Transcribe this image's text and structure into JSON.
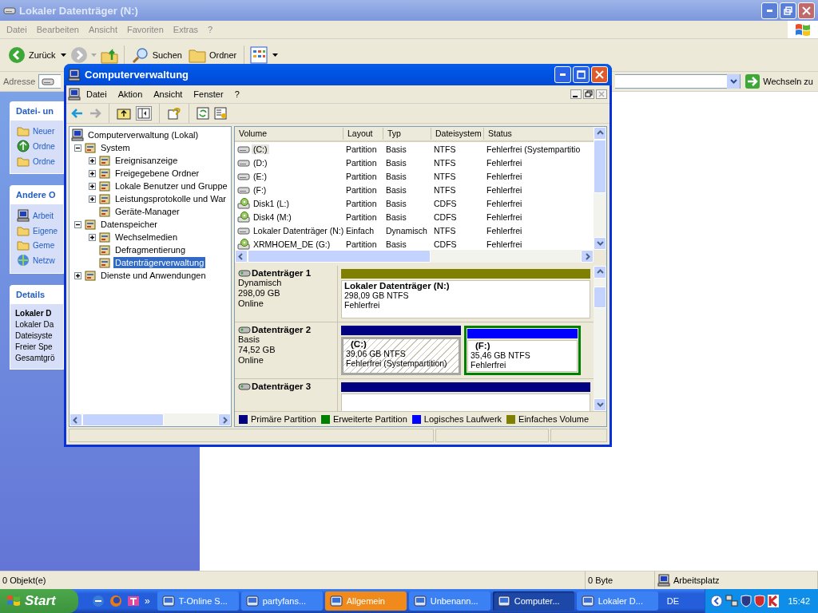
{
  "explorer": {
    "title": "Lokaler Datenträger (N:)",
    "menu": [
      "Datei",
      "Bearbeiten",
      "Ansicht",
      "Favoriten",
      "Extras",
      "?"
    ],
    "toolbar": {
      "back": "Zurück",
      "search": "Suchen",
      "folders": "Ordner"
    },
    "address": {
      "label": "Adresse",
      "go": "Wechseln zu"
    },
    "task_panes": [
      {
        "title": "Datei- un",
        "items": [
          "Neuer",
          "Ordne",
          "Ordne"
        ]
      },
      {
        "title": "Andere O",
        "items": [
          "Arbeit",
          "Eigene",
          "Geme",
          "Netzw"
        ]
      }
    ],
    "details": {
      "title": "Details",
      "heading": "Lokaler D",
      "lines": [
        "Lokaler Da",
        "Dateisyste",
        "Freier Spe",
        "Gesamtgrö"
      ]
    },
    "status_bar": [
      "0 Objekt(e)",
      "0 Byte",
      "Arbeitsplatz"
    ]
  },
  "mmc": {
    "title": "Computerverwaltung",
    "menu": [
      "Datei",
      "Aktion",
      "Ansicht",
      "Fenster",
      "?"
    ],
    "tree": [
      {
        "label": "Computerverwaltung (Lokal)",
        "selected": false,
        "children": [
          {
            "label": "System",
            "expanded": true,
            "selected": false,
            "children": [
              {
                "label": "Ereignisanzeige",
                "expanded": false,
                "selected": false
              },
              {
                "label": "Freigegebene Ordner",
                "expanded": false,
                "selected": false
              },
              {
                "label": "Lokale Benutzer und Gruppe",
                "expanded": false,
                "selected": false
              },
              {
                "label": "Leistungsprotokolle und War",
                "expanded": false,
                "selected": false
              },
              {
                "label": "Geräte-Manager",
                "selected": false
              }
            ]
          },
          {
            "label": "Datenspeicher",
            "expanded": true,
            "selected": false,
            "children": [
              {
                "label": "Wechselmedien",
                "expanded": false,
                "selected": false
              },
              {
                "label": "Defragmentierung",
                "selected": false
              },
              {
                "label": "Datenträgerverwaltung",
                "selected": true
              }
            ]
          },
          {
            "label": "Dienste und Anwendungen",
            "expanded": false,
            "selected": false
          }
        ]
      }
    ],
    "volumes": {
      "columns": [
        "Volume",
        "Layout",
        "Typ",
        "Dateisystem",
        "Status"
      ],
      "rows": [
        {
          "kind": "disk",
          "selected": true,
          "cells": [
            "(C:)",
            "Partition",
            "Basis",
            "NTFS",
            "Fehlerfrei (Systempartitio"
          ]
        },
        {
          "kind": "disk",
          "selected": false,
          "cells": [
            "(D:)",
            "Partition",
            "Basis",
            "NTFS",
            "Fehlerfrei"
          ]
        },
        {
          "kind": "disk",
          "selected": false,
          "cells": [
            "(E:)",
            "Partition",
            "Basis",
            "NTFS",
            "Fehlerfrei"
          ]
        },
        {
          "kind": "disk",
          "selected": false,
          "cells": [
            "(F:)",
            "Partition",
            "Basis",
            "NTFS",
            "Fehlerfrei"
          ]
        },
        {
          "kind": "cd",
          "selected": false,
          "cells": [
            "Disk1 (L:)",
            "Partition",
            "Basis",
            "CDFS",
            "Fehlerfrei"
          ]
        },
        {
          "kind": "cd",
          "selected": false,
          "cells": [
            "Disk4 (M:)",
            "Partition",
            "Basis",
            "CDFS",
            "Fehlerfrei"
          ]
        },
        {
          "kind": "disk",
          "selected": false,
          "cells": [
            "Lokaler Datenträger (N:)",
            "Einfach",
            "Dynamisch",
            "NTFS",
            "Fehlerfrei"
          ]
        },
        {
          "kind": "cd",
          "selected": false,
          "cells": [
            "XRMHOEM_DE (G:)",
            "Partition",
            "Basis",
            "CDFS",
            "Fehlerfrei"
          ]
        }
      ]
    },
    "disks": [
      {
        "name": "Datenträger 1",
        "info": [
          "Dynamisch",
          "298,09 GB",
          "Online"
        ],
        "partitions": [
          {
            "kind": "simple",
            "color": "#808000",
            "selected": false,
            "name": "Lokaler Datenträger  (N:)",
            "size": "298,09 GB NTFS",
            "status": "Fehlerfrei"
          }
        ]
      },
      {
        "name": "Datenträger 2",
        "info": [
          "Basis",
          "74,52 GB",
          "Online"
        ],
        "partitions": [
          {
            "kind": "primary",
            "color": "#000080",
            "selected": true,
            "name": "(C:)",
            "size": "39,06 GB NTFS",
            "status": "Fehlerfrei (Systempartition)"
          },
          {
            "kind": "logical",
            "color": "#0000ff",
            "selected": false,
            "name": "(F:)",
            "size": "35,46 GB NTFS",
            "status": "Fehlerfrei"
          }
        ]
      },
      {
        "name": "Datenträger 3",
        "partitions": [
          {
            "kind": "primary",
            "color": "#000080",
            "selected": false
          }
        ]
      }
    ],
    "legend": [
      {
        "label": "Primäre Partition",
        "color": "#000080"
      },
      {
        "label": "Erweiterte Partition",
        "color": "#008000"
      },
      {
        "label": "Logisches Laufwerk",
        "color": "#0000ff"
      },
      {
        "label": "Einfaches Volume",
        "color": "#808000"
      }
    ]
  },
  "taskbar": {
    "start": "Start",
    "more": "»",
    "tasks": [
      {
        "label": "T-Online S...",
        "selected": false,
        "flashing": false
      },
      {
        "label": "partyfans...",
        "selected": false,
        "flashing": false
      },
      {
        "label": "Allgemein",
        "selected": false,
        "flashing": true
      },
      {
        "label": "Unbenann...",
        "selected": false,
        "flashing": false
      },
      {
        "label": "Computer...",
        "selected": true,
        "flashing": false
      },
      {
        "label": "Lokaler D...",
        "selected": false,
        "flashing": false
      }
    ],
    "language": "DE",
    "clock": "15:42"
  }
}
